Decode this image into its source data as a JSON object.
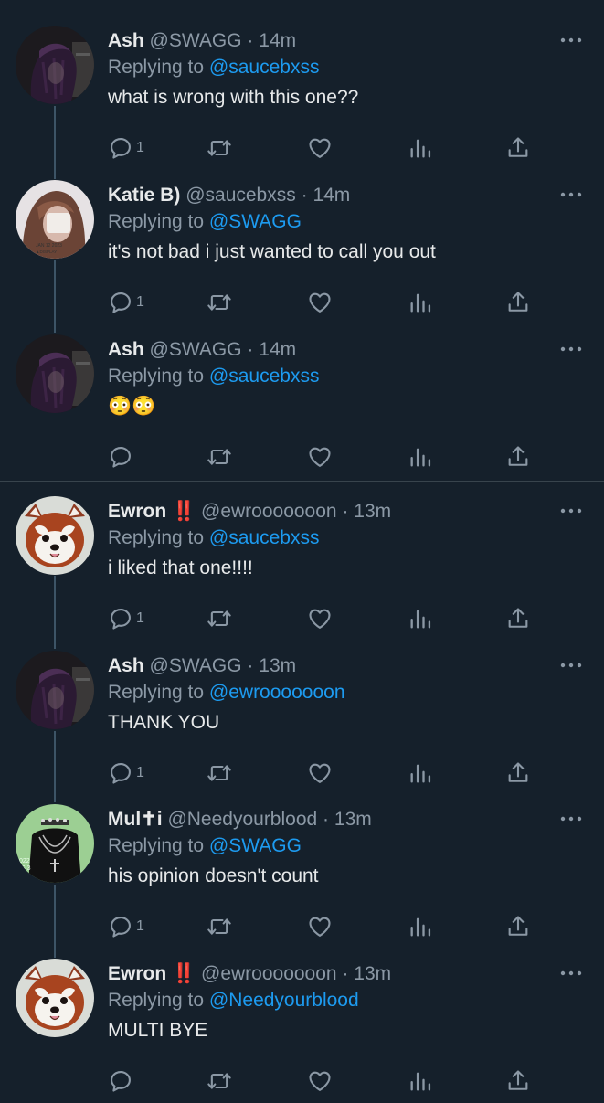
{
  "tweets": [
    {
      "name": "Ash",
      "handle": "@SWAGG",
      "dot": "·",
      "time": "14m",
      "replying_prefix": "Replying to",
      "mention": "@saucebxss",
      "text": "what is wrong with this one??",
      "reply_count": "1",
      "avatar": "ash"
    },
    {
      "name": "Katie B)",
      "handle": "@saucebxss",
      "dot": "·",
      "time": "14m",
      "replying_prefix": "Replying to",
      "mention": "@SWAGG",
      "text": "it's not bad i just wanted to call you out",
      "reply_count": "1",
      "avatar": "katie"
    },
    {
      "name": "Ash",
      "handle": "@SWAGG",
      "dot": "·",
      "time": "14m",
      "replying_prefix": "Replying to",
      "mention": "@saucebxss",
      "text": "😳😳",
      "reply_count": "",
      "avatar": "ash"
    },
    {
      "name": "Ewron ‼️",
      "handle": "@ewrooooooon",
      "dot": "·",
      "time": "13m",
      "replying_prefix": "Replying to",
      "mention": "@saucebxss",
      "text": "i liked that one!!!!",
      "reply_count": "1",
      "avatar": "redpanda"
    },
    {
      "name": "Ash",
      "handle": "@SWAGG",
      "dot": "·",
      "time": "13m",
      "replying_prefix": "Replying to",
      "mention": "@ewrooooooon",
      "text": "THANK YOU",
      "reply_count": "1",
      "avatar": "ash"
    },
    {
      "name": "Mul✝i",
      "handle": "@Needyourblood",
      "dot": "·",
      "time": "13m",
      "replying_prefix": "Replying to",
      "mention": "@SWAGG",
      "text": "his opinion doesn't count",
      "reply_count": "1",
      "avatar": "multi"
    },
    {
      "name": "Ewron ‼️",
      "handle": "@ewrooooooon",
      "dot": "·",
      "time": "13m",
      "replying_prefix": "Replying to",
      "mention": "@Needyourblood",
      "text": "MULTI BYE",
      "reply_count": "",
      "avatar": "redpanda"
    }
  ],
  "avatar_text": {
    "katie_stamp": "JAN 12 2023",
    "katie_stamp2": "▲DISPLAY",
    "multi_stamp": "022",
    "multi_stamp2": "S.3"
  },
  "colors": {
    "background": "#15202b",
    "divider": "#38444d",
    "mention": "#1d9bf0",
    "muted": "#8b98a5",
    "text": "#e7e9ea"
  }
}
